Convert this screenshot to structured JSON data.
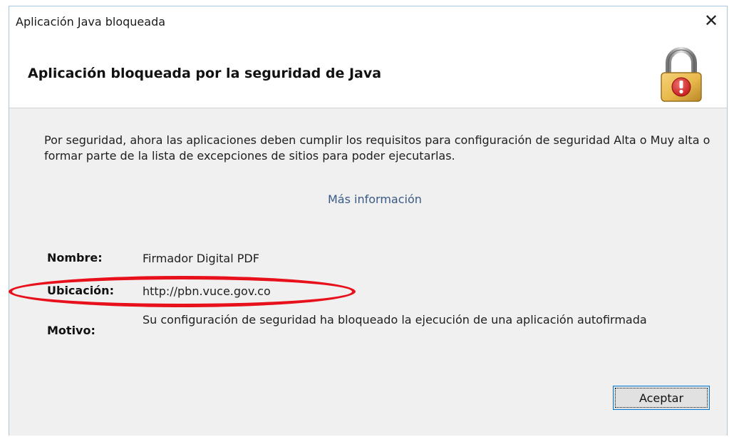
{
  "window": {
    "title": "Aplicación Java bloqueada",
    "close_glyph": "✕"
  },
  "header": {
    "title": "Aplicación bloqueada por la seguridad de Java",
    "icon": "lock-warning-icon"
  },
  "content": {
    "description": "Por seguridad, ahora las aplicaciones deben cumplir los requisitos para configuración de seguridad Alta o Muy alta o formar parte de la lista de excepciones de sitios para poder ejecutarlas.",
    "more_info_link": "Más información",
    "fields": {
      "name": {
        "label": "Nombre:",
        "value": "Firmador Digital PDF"
      },
      "location": {
        "label": "Ubicación:",
        "value": "http://pbn.vuce.gov.co"
      },
      "reason": {
        "label": "Motivo:",
        "value": "Su configuración de seguridad ha bloqueado la ejecución de una aplicación autofirmada"
      }
    }
  },
  "buttons": {
    "accept_label": "Aceptar"
  },
  "colors": {
    "link": "#3a5a86",
    "highlight": "#e8101a",
    "lock_gold": "#e8b84a",
    "warning_red": "#d42a2a",
    "focus_border": "#0078d7"
  }
}
